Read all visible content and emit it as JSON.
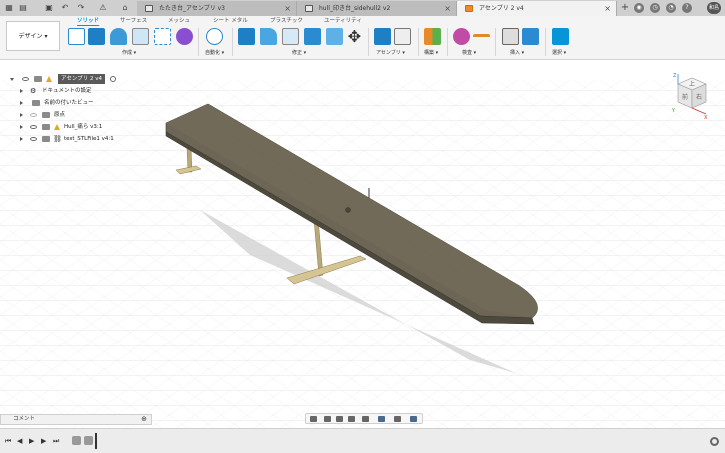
{
  "titlebar": {
    "tabs": [
      {
        "label": "たたき台_アセンブリ v3",
        "active": false
      },
      {
        "label": "hull_印き台_sidehull2 v2",
        "active": false
      },
      {
        "label": "アセンブリ 2 v4",
        "active": true
      }
    ],
    "user": "和島"
  },
  "ribbon": {
    "workspace": "デザイン ▾",
    "tabs": [
      "ソリッド",
      "サーフェス",
      "メッシュ",
      "シート メタル",
      "プラスチック",
      "ユーティリティ"
    ],
    "groups": [
      "作成 ▾",
      "自動化 ▾",
      "修正 ▾",
      "アセンブリ ▾",
      "構築 ▾",
      "検査 ▾",
      "挿入 ▾",
      "選択 ▾"
    ]
  },
  "browser": {
    "root": "アセンブリ 2 v4",
    "items": [
      "ドキュメントの設定",
      "名前の付いたビュー",
      "原点",
      "Hull_痛ら v3:1",
      "test_STLFile1 v4:1"
    ]
  },
  "viewcube": {
    "top": "上",
    "front": "前",
    "right": "右",
    "axis_x": "X",
    "axis_y": "Y",
    "axis_z": "Z"
  },
  "bottom": {
    "comment": "コメント"
  },
  "colors": {
    "accent": "#0696d7",
    "hull": "#6d6656",
    "foil": "#c9b98a"
  }
}
